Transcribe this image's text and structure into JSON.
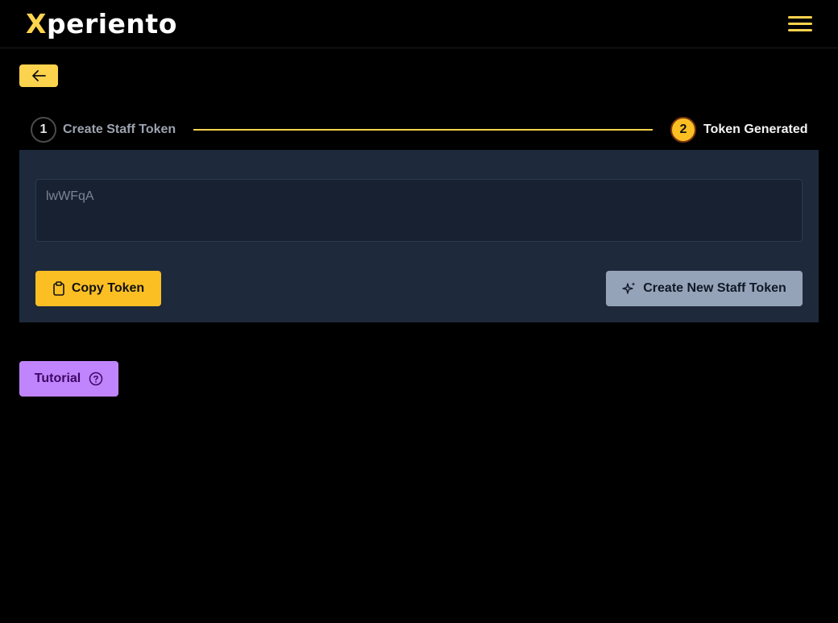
{
  "header": {
    "logo_first": "X",
    "logo_rest": "periento",
    "menu_icon": "hamburger-menu-icon"
  },
  "nav": {
    "back_icon": "arrow-left-icon"
  },
  "stepper": {
    "steps": [
      {
        "number": "1",
        "label": "Create Staff Token",
        "state": "completed"
      },
      {
        "number": "2",
        "label": "Token Generated",
        "state": "active"
      }
    ]
  },
  "token": {
    "value": "lwWFqA"
  },
  "actions": {
    "copy_label": "Copy Token",
    "copy_icon": "clipboard-icon",
    "create_label": "Create New Staff Token",
    "create_icon": "sparkles-icon"
  },
  "tutorial": {
    "label": "Tutorial",
    "icon": "question-circle-icon"
  },
  "colors": {
    "accent": "#fcd34d",
    "panel": "#1e293b",
    "tutorial": "#c084fc",
    "secondary_button": "#94a3b8"
  }
}
